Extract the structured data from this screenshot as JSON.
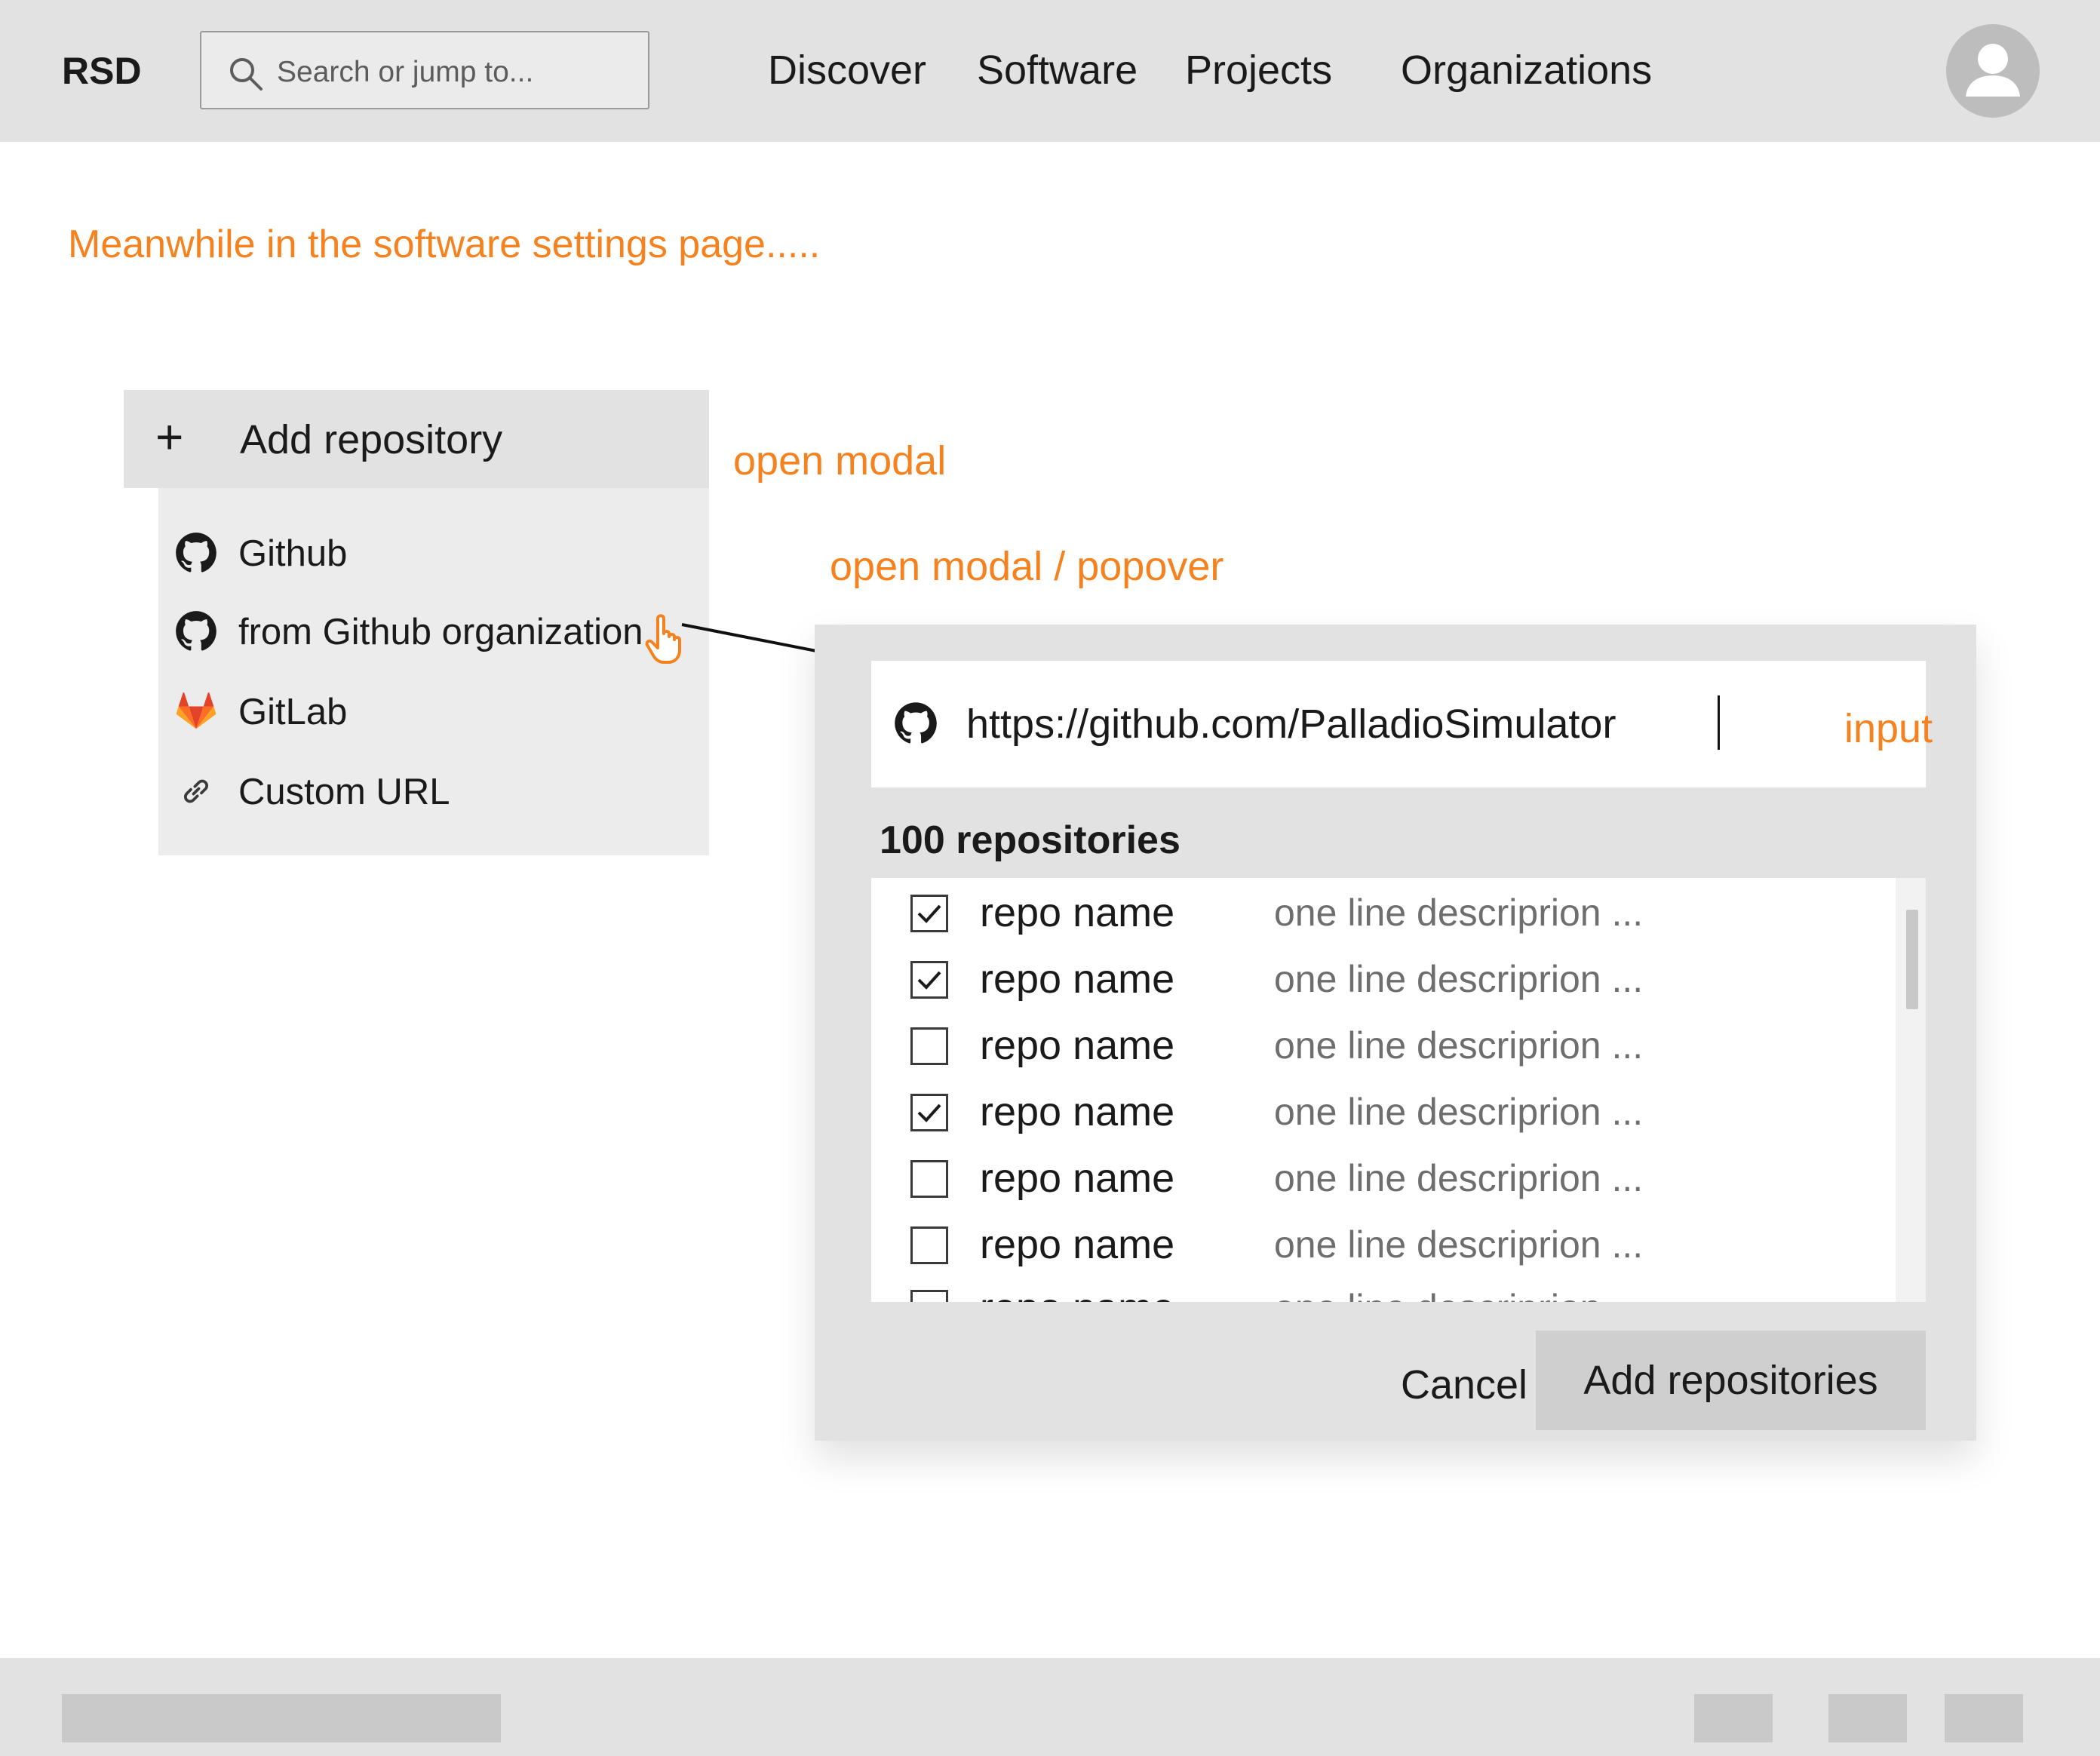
{
  "header": {
    "logo": "RSD",
    "search_placeholder": "Search or jump to...",
    "nav": [
      "Discover",
      "Software",
      "Projects",
      "Organizations"
    ]
  },
  "annotations": {
    "page_note": "Meanwhile in the software settings page.....",
    "open_modal": "open modal",
    "open_modal_popover": "open modal / popover",
    "input": "input"
  },
  "menu": {
    "add_label": "Add repository",
    "plus": "+",
    "items": [
      {
        "label": "Github",
        "icon": "github-icon"
      },
      {
        "label": "from Github organization",
        "icon": "github-icon"
      },
      {
        "label": "GitLab",
        "icon": "gitlab-icon"
      },
      {
        "label": "Custom URL",
        "icon": "link-icon"
      }
    ]
  },
  "modal": {
    "url_value": "https://github.com/PalladioSimulator",
    "count_label": "100 repositories",
    "repos": [
      {
        "name": "repo name",
        "description": "one line descriprion ...",
        "checked": true
      },
      {
        "name": "repo name",
        "description": "one line descriprion ...",
        "checked": true
      },
      {
        "name": "repo name",
        "description": "one line descriprion ...",
        "checked": false
      },
      {
        "name": "repo name",
        "description": "one line descriprion ...",
        "checked": true
      },
      {
        "name": "repo name",
        "description": "one line descriprion ...",
        "checked": false
      },
      {
        "name": "repo name",
        "description": "one line descriprion ...",
        "checked": false
      },
      {
        "name": "repo name",
        "description": "one line descriprion",
        "checked": false
      }
    ],
    "cancel_label": "Cancel",
    "add_label": "Add repositories"
  },
  "colors": {
    "annotation": "#f5821f",
    "chrome": "#e2e2e2",
    "gitlab_orange": "#fc6d26",
    "gitlab_red": "#e24329"
  }
}
